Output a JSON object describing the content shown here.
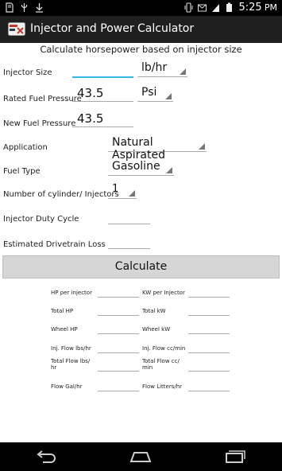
{
  "status_bar": {
    "time": "5:25",
    "time_suffix": "PM",
    "left_icons": [
      "sd-card-icon",
      "usb-icon",
      "download-icon"
    ],
    "right_icons": [
      "vibrate-icon",
      "gmail-icon",
      "sim-icon",
      "battery-icon"
    ]
  },
  "action_bar": {
    "title": "Injector and Power Calculator"
  },
  "subtitle": "Calculate horsepower based on injector size",
  "form": {
    "injector_size_label": "Injector Size",
    "injector_size_value": "",
    "injector_unit": "lb/hr",
    "rated_pressure_label": "Rated Fuel Pressure",
    "rated_pressure_value": "43.5",
    "pressure_unit": "Psi",
    "new_pressure_label": "New Fuel Pressure",
    "new_pressure_value": "43.5",
    "application_label": "Application",
    "application_value": "Natural Aspirated",
    "fuel_type_label": "Fuel Type",
    "fuel_type_value": "Gasoline",
    "cylinders_label": "Number of cylinder/ Injectors",
    "cylinders_value": "1",
    "duty_cycle_label": "Injector Duty Cycle",
    "duty_cycle_value": "",
    "drivetrain_loss_label": "Estimated Drivetrain Loss",
    "drivetrain_loss_value": ""
  },
  "calculate_label": "Calculate",
  "results": {
    "hp_per_injector": "HP per injector",
    "kw_per_injector": "KW per Injector",
    "total_hp": "Total HP",
    "total_kw": "Total kW",
    "wheel_hp": "Wheel HP",
    "wheel_kw": "Wheel kW",
    "inj_flow_lbs": "Inj. Flow lbs/hr",
    "inj_flow_cc": "Inj. Flow cc/min",
    "total_flow_lbs": "Total Flow lbs/ hr",
    "total_flow_cc": "Total Flow cc/ min",
    "flow_gal": "Flow Gal/hr",
    "flow_litters": "Flow Litters/hr"
  },
  "nav": {
    "icons": [
      "back-icon",
      "home-icon",
      "recents-icon"
    ]
  }
}
